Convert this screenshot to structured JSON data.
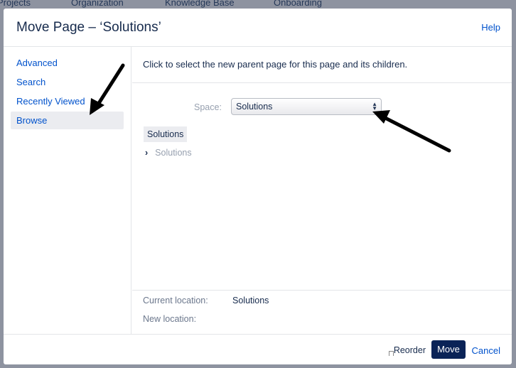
{
  "background_nav": [
    "Projects",
    "Organization",
    "Knowledge Base",
    "Onboarding"
  ],
  "dialog": {
    "title": "Move Page – ‘Solutions’",
    "help": "Help"
  },
  "sidebar": {
    "items": [
      {
        "label": "Advanced"
      },
      {
        "label": "Search"
      },
      {
        "label": "Recently Viewed"
      },
      {
        "label": "Browse"
      }
    ]
  },
  "main": {
    "instruction": "Click to select the new parent page for this page and its children.",
    "space_label": "Space:",
    "space_value": "Solutions",
    "tree": {
      "root": "Solutions",
      "child": "Solutions"
    },
    "current_location_label": "Current location:",
    "current_location_value": "Solutions",
    "new_location_label": "New location:"
  },
  "footer": {
    "reorder": "Reorder",
    "move": "Move",
    "cancel": "Cancel"
  }
}
